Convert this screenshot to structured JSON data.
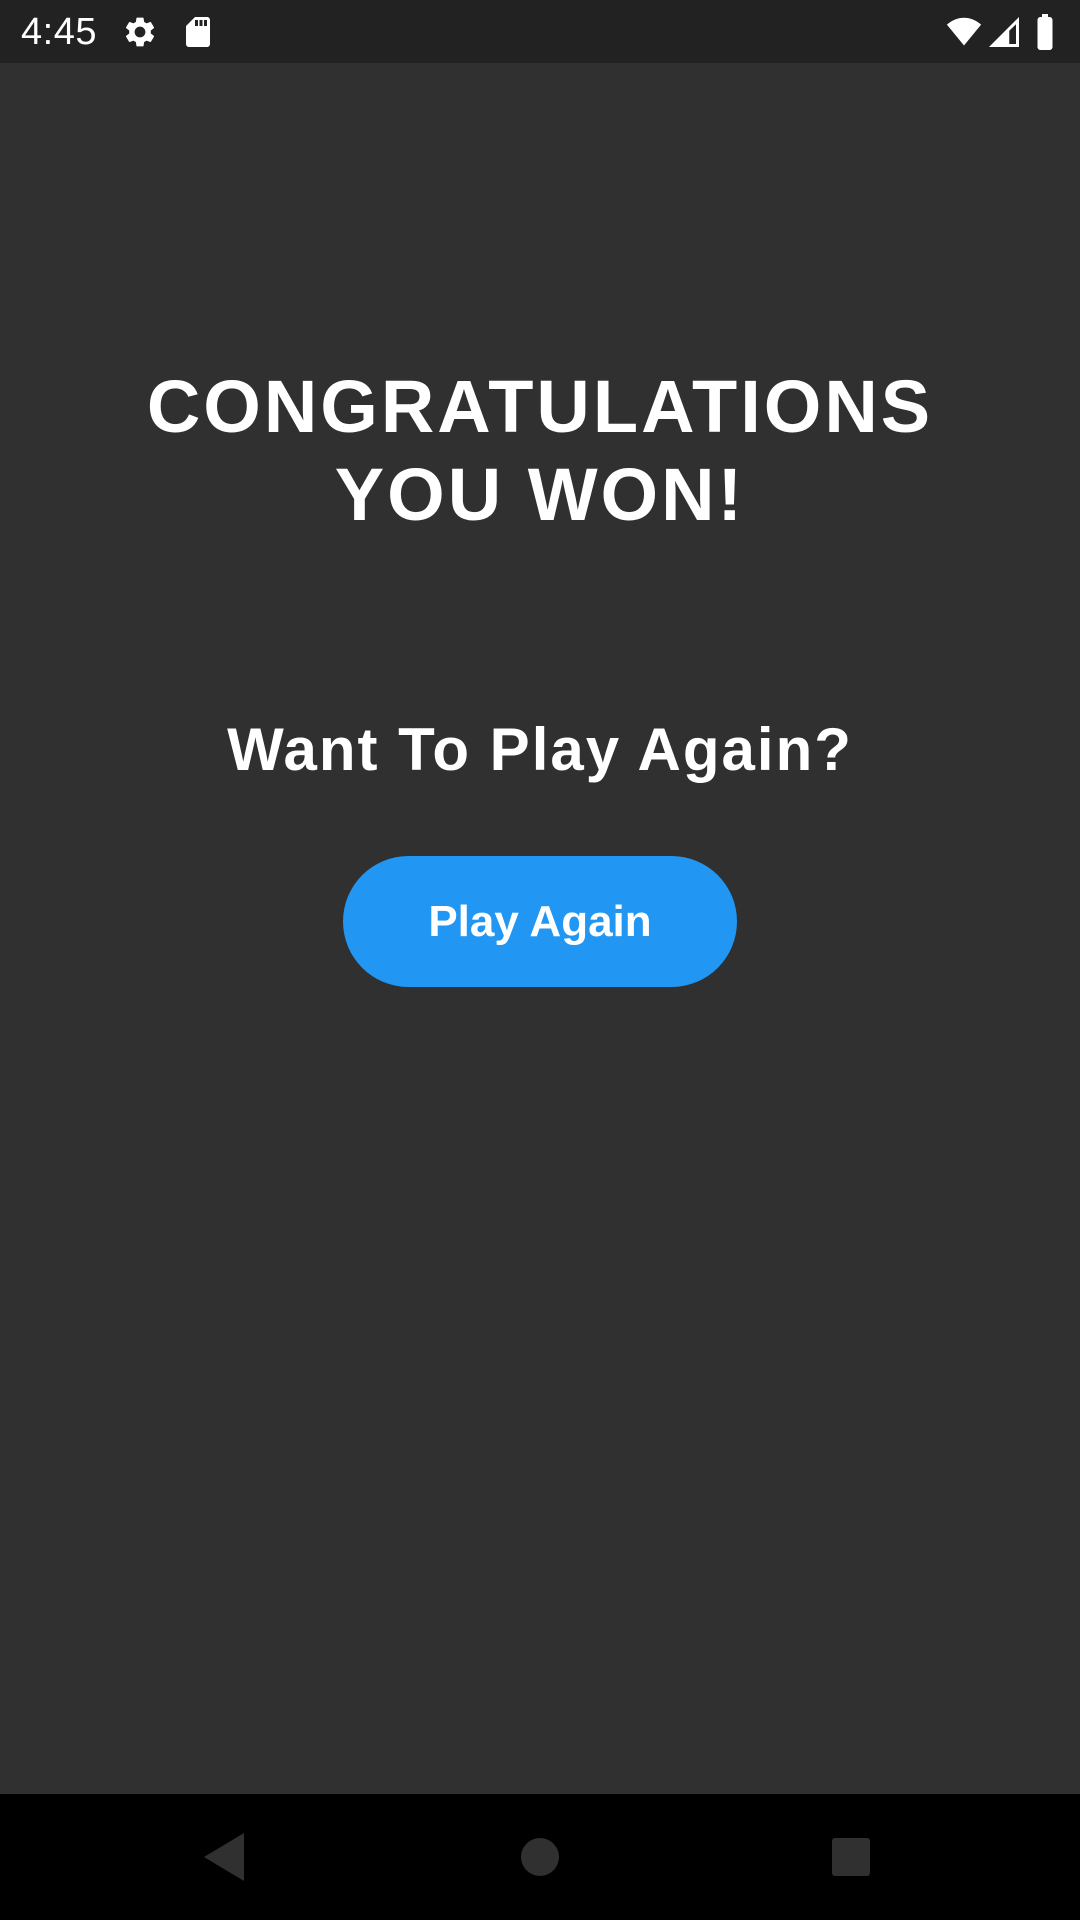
{
  "status_bar": {
    "time": "4:45",
    "icons": [
      "settings-icon",
      "sd-card-icon",
      "wifi-icon",
      "signal-icon",
      "battery-icon"
    ]
  },
  "main": {
    "title_line1": "CONGRATULATIONS",
    "title_line2": "YOU WON!",
    "subtitle": "Want To Play Again?",
    "play_again_label": "Play Again"
  },
  "nav_bar": {
    "icons": [
      "back-icon",
      "home-icon",
      "recents-icon"
    ]
  },
  "colors": {
    "background": "#303030",
    "status_bar": "#222222",
    "nav_bar": "#000000",
    "accent": "#2196F3",
    "text": "#ffffff"
  }
}
